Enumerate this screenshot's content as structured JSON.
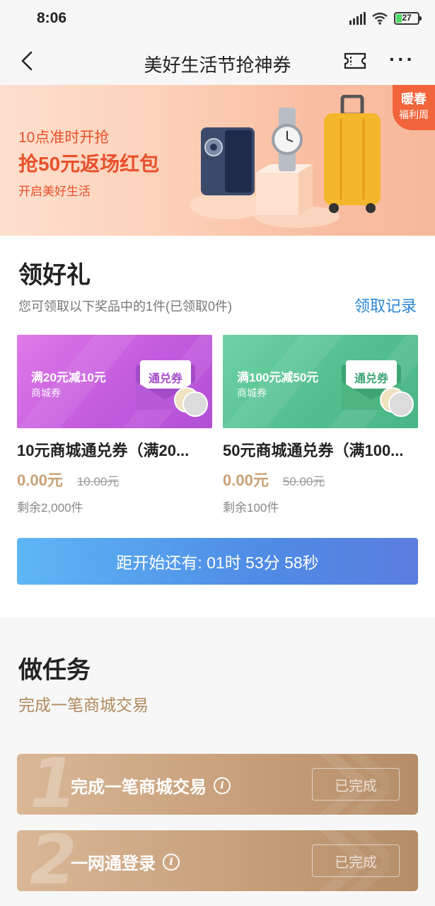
{
  "status_bar": {
    "time": "8:06",
    "battery": "27",
    "battery_level": 0.27
  },
  "nav": {
    "title": "美好生活节抢神券",
    "back_icon": "chevron-left-icon",
    "ticket_icon": "ticket-icon",
    "more_icon": "more-icon"
  },
  "banner": {
    "line1": "10点准时开抢",
    "line2": "抢50元返场红包",
    "line3": "开启美好生活",
    "badge_line1": "暖春",
    "badge_line2": "福利周"
  },
  "gift": {
    "title": "领好礼",
    "subtitle": "您可领取以下奖品中的1件(已领取0件)",
    "record_link": "领取记录",
    "cards": [
      {
        "condition": "满20元减10元",
        "type": "商城券",
        "envelope_label": "通兑券",
        "title": "10元商城通兑券（满20...",
        "price": "0.00元",
        "original_price": "10.00元",
        "stock": "剩余2,000件"
      },
      {
        "condition": "满100元减50元",
        "type": "商城券",
        "envelope_label": "通兑券",
        "title": "50元商城通兑券（满100...",
        "price": "0.00元",
        "original_price": "50.00元",
        "stock": "剩余100件"
      }
    ],
    "countdown": "距开始还有: 01时 53分 58秒"
  },
  "task": {
    "title": "做任务",
    "subtitle": "完成一笔商城交易",
    "items": [
      {
        "number": "1",
        "label": "完成一笔商城交易",
        "status": "已完成"
      },
      {
        "number": "2",
        "label": "一网通登录",
        "status": "已完成"
      }
    ]
  },
  "colors": {
    "accent_orange": "#e8512b",
    "link_blue": "#2a87d6",
    "price_gold": "#c8a276",
    "card1_purple": "#c85ee0",
    "card2_green": "#5fc79a"
  }
}
